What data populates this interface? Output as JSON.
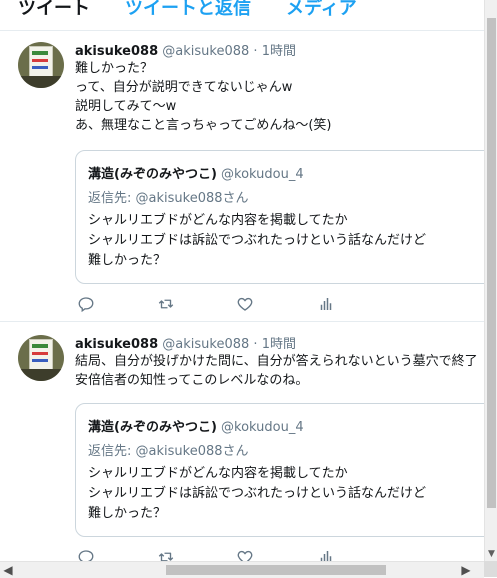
{
  "tabs": [
    "ツイート",
    "ツイートと返信",
    "メディア"
  ],
  "tweets": [
    {
      "name": "akisuke088",
      "handle": "@akisuke088",
      "dot": "·",
      "time": "1時間",
      "lines": [
        "難しかった？",
        "って、自分が説明できてないじゃんw",
        "説明してみて〜w",
        "あ、無理なこと言っちゃってごめんね〜(笑)"
      ],
      "quote": {
        "name": "溝造(みぞのみやつこ)",
        "handle": "@kokudou_4",
        "reply_prefix": "返信先: ",
        "reply_to": "@akisuke088さん",
        "lines": [
          "シャルリエブドがどんな内容を掲載してたか",
          "シャルリエブドは訴訟でつぶれたっけという話なんだけど",
          "難しかった？"
        ]
      }
    },
    {
      "name": "akisuke088",
      "handle": "@akisuke088",
      "dot": "·",
      "time": "1時間",
      "lines": [
        "結局、自分が投げかけた問に、自分が答えられないという墓穴で終了",
        "安倍信者の知性ってこのレベルなのね。"
      ],
      "quote": {
        "name": "溝造(みぞのみやつこ)",
        "handle": "@kokudou_4",
        "reply_prefix": "返信先: ",
        "reply_to": "@akisuke088さん",
        "lines": [
          "シャルリエブドがどんな内容を掲載してたか",
          "シャルリエブドは訴訟でつぶれたっけという話なんだけど",
          "難しかった？"
        ]
      }
    }
  ],
  "colors": {
    "accent": "#1da1f2",
    "muted": "#657786",
    "border": "#e6ecf0"
  },
  "icons": [
    "reply-icon",
    "retweet-icon",
    "like-icon",
    "analytics-icon"
  ]
}
